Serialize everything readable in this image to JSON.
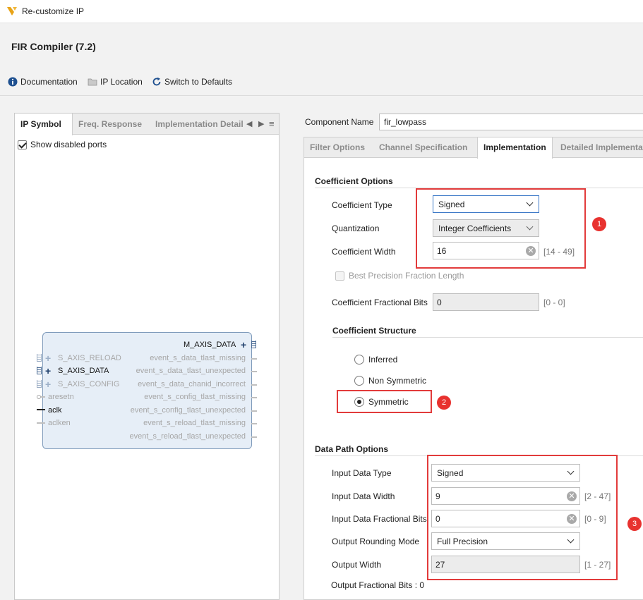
{
  "window": {
    "title": "Re-customize IP"
  },
  "ip": {
    "name": "FIR Compiler (7.2)"
  },
  "toolbar": {
    "documentation": "Documentation",
    "ip_location": "IP Location",
    "switch_defaults": "Switch to Defaults"
  },
  "left_panel": {
    "tabs": [
      "IP Symbol",
      "Freq. Response",
      "Implementation Detail"
    ],
    "show_disabled_ports": "Show disabled ports",
    "symbol": {
      "left_ports": [
        "S_AXIS_RELOAD",
        "S_AXIS_DATA",
        "S_AXIS_CONFIG",
        "aresetn",
        "aclk",
        "aclken"
      ],
      "right_ports": [
        "M_AXIS_DATA",
        "event_s_data_tlast_missing",
        "event_s_data_tlast_unexpected",
        "event_s_data_chanid_incorrect",
        "event_s_config_tlast_missing",
        "event_s_config_tlast_unexpected",
        "event_s_reload_tlast_missing",
        "event_s_reload_tlast_unexpected"
      ]
    }
  },
  "component": {
    "label": "Component Name",
    "value": "fir_lowpass"
  },
  "right_tabs": [
    "Filter Options",
    "Channel Specification",
    "Implementation",
    "Detailed Implementatio"
  ],
  "coefficient_options": {
    "title": "Coefficient Options",
    "coefficient_type": {
      "label": "Coefficient Type",
      "value": "Signed"
    },
    "quantization": {
      "label": "Quantization",
      "value": "Integer Coefficients"
    },
    "coefficient_width": {
      "label": "Coefficient Width",
      "value": "16",
      "range": "[14 - 49]"
    },
    "best_precision": {
      "label": "Best Precision Fraction Length"
    },
    "fractional_bits": {
      "label": "Coefficient Fractional Bits",
      "value": "0",
      "range": "[0 - 0]"
    }
  },
  "coefficient_structure": {
    "title": "Coefficient Structure",
    "options": [
      "Inferred",
      "Non Symmetric",
      "Symmetric"
    ],
    "selected": "Symmetric"
  },
  "data_path": {
    "title": "Data Path Options",
    "input_data_type": {
      "label": "Input Data Type",
      "value": "Signed"
    },
    "input_data_width": {
      "label": "Input Data Width",
      "value": "9",
      "range": "[2 - 47]"
    },
    "input_fractional_bits": {
      "label": "Input Data Fractional Bits",
      "value": "0",
      "range": "[0 - 9]"
    },
    "output_rounding": {
      "label": "Output Rounding Mode",
      "value": "Full Precision"
    },
    "output_width": {
      "label": "Output Width",
      "value": "27",
      "range": "[1 - 27]"
    },
    "output_fractional": "Output Fractional Bits : 0"
  },
  "annotations": {
    "badges": [
      "1",
      "2",
      "3"
    ],
    "highlight_color": "#e23b3b"
  },
  "icons": {
    "documentation": "info-icon",
    "ip_location": "folder-icon",
    "switch_defaults": "refresh-icon"
  }
}
